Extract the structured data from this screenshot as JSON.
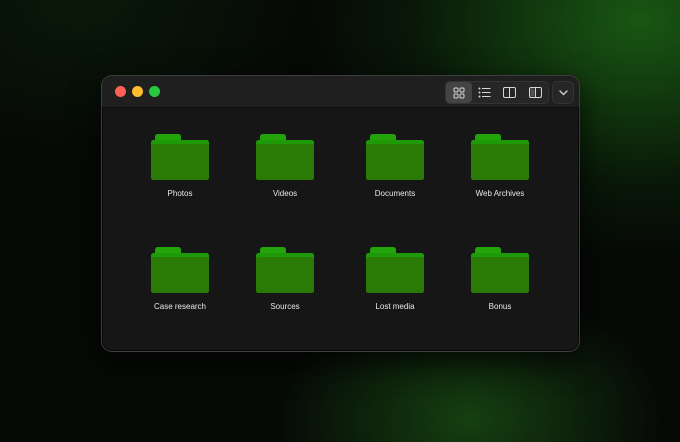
{
  "window": {
    "controls": [
      {
        "name": "close",
        "color": "#fe5f57"
      },
      {
        "name": "minimize",
        "color": "#febc2e"
      },
      {
        "name": "zoom",
        "color": "#28c840"
      }
    ]
  },
  "toolbar": {
    "view_buttons": [
      {
        "icon": "grid-view-icon",
        "active": true
      },
      {
        "icon": "list-view-icon",
        "active": false
      },
      {
        "icon": "column-view-icon",
        "active": false
      },
      {
        "icon": "gallery-view-icon",
        "active": false
      }
    ],
    "menu_icon": "chevron-down-icon"
  },
  "colors": {
    "folder_back": "#1e9a08",
    "folder_front": "#2a7a06",
    "folder_tab": "#22a40a"
  },
  "folders": [
    {
      "label": "Photos"
    },
    {
      "label": "Videos"
    },
    {
      "label": "Documents"
    },
    {
      "label": "Web Archives"
    },
    {
      "label": "Case research"
    },
    {
      "label": "Sources"
    },
    {
      "label": "Lost media"
    },
    {
      "label": "Bonus"
    }
  ]
}
